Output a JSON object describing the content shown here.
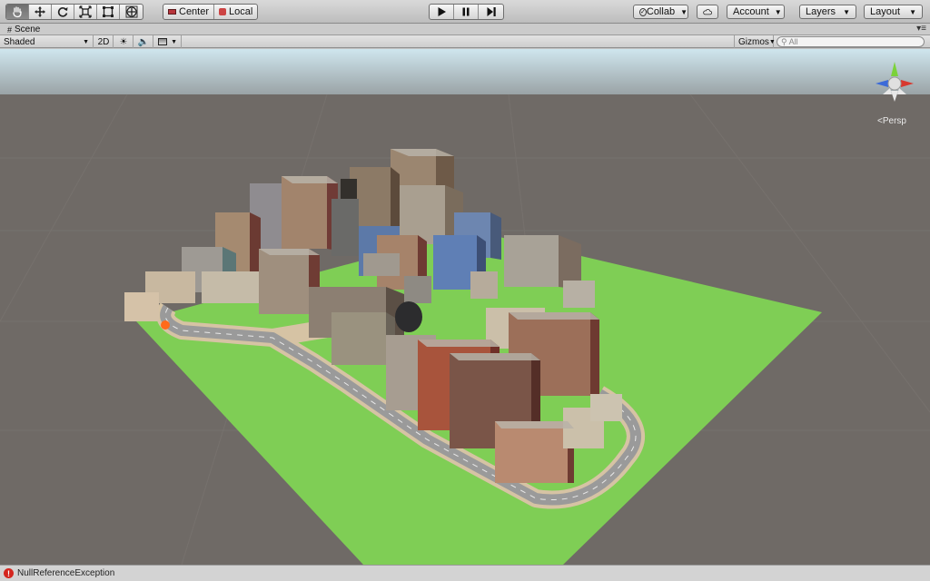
{
  "toolbar": {
    "tools": [
      "hand-icon",
      "move-icon",
      "rotate-icon",
      "scale-icon",
      "rect-icon",
      "transform-icon"
    ],
    "pivot_label": "Center",
    "space_label": "Local",
    "playback": [
      "play-icon",
      "pause-icon",
      "step-icon"
    ],
    "collab_label": "Collab",
    "account_label": "Account",
    "layers_label": "Layers",
    "layout_label": "Layout"
  },
  "scene_tab": {
    "label": "Scene"
  },
  "scene_bar": {
    "shading_mode": "Shaded",
    "mode_2d": "2D",
    "gizmos_label": "Gizmos",
    "search_placeholder": "All"
  },
  "viewport": {
    "projection_label": "Persp",
    "sky_color": "#cfe6ee",
    "ground_color": "#6f6a66",
    "grass_color": "#7fce55"
  },
  "status": {
    "message": "NullReferenceException"
  }
}
